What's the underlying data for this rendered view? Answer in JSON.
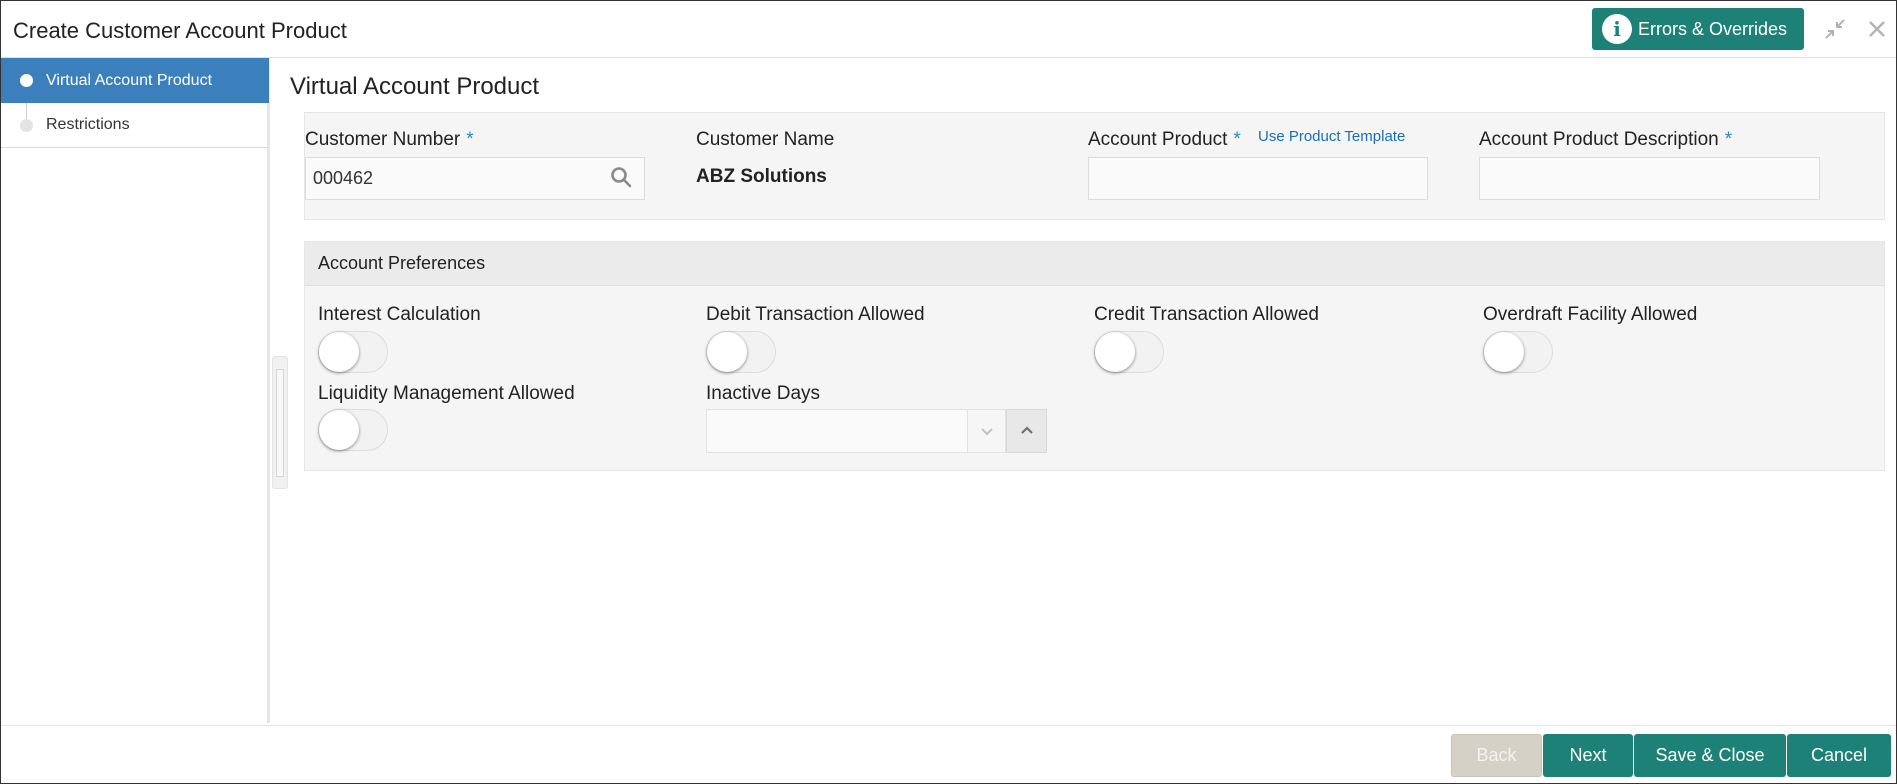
{
  "window": {
    "title": "Create Customer Account Product",
    "errors_button_label": "Errors & Overrides",
    "info_icon_glyph": "i",
    "icons": [
      "info-icon",
      "collapse-icon",
      "close-icon"
    ]
  },
  "sidebar": {
    "items": [
      {
        "label": "Virtual Account Product",
        "active": true
      },
      {
        "label": "Restrictions",
        "active": false
      }
    ]
  },
  "main": {
    "section_title": "Virtual Account Product",
    "customer_number": {
      "label": "Customer Number",
      "required_mark": "*",
      "value": "000462",
      "icon": "search-icon"
    },
    "customer_name": {
      "label": "Customer Name",
      "value": "ABZ Solutions"
    },
    "account_product": {
      "label": "Account Product",
      "required_mark": "*",
      "link_label": "Use Product Template",
      "value": ""
    },
    "account_product_description": {
      "label": "Account Product Description",
      "required_mark": "*",
      "value": ""
    }
  },
  "preferences": {
    "header": "Account Preferences",
    "toggles": [
      {
        "label": "Interest Calculation",
        "on": false
      },
      {
        "label": "Debit Transaction Allowed",
        "on": false
      },
      {
        "label": "Credit Transaction Allowed",
        "on": false
      },
      {
        "label": "Overdraft Facility Allowed",
        "on": false
      },
      {
        "label": "Liquidity Management Allowed",
        "on": false
      }
    ],
    "inactive_days": {
      "label": "Inactive Days",
      "value": ""
    }
  },
  "footer": {
    "back_label": "Back",
    "next_label": "Next",
    "save_close_label": "Save & Close",
    "cancel_label": "Cancel"
  },
  "colors": {
    "accent_teal": "#1e8177",
    "sidebar_active": "#3b7fbd",
    "required_mark": "#2a88c7",
    "link": "#1a6fb3",
    "disabled_button": "#d5d1c6"
  }
}
